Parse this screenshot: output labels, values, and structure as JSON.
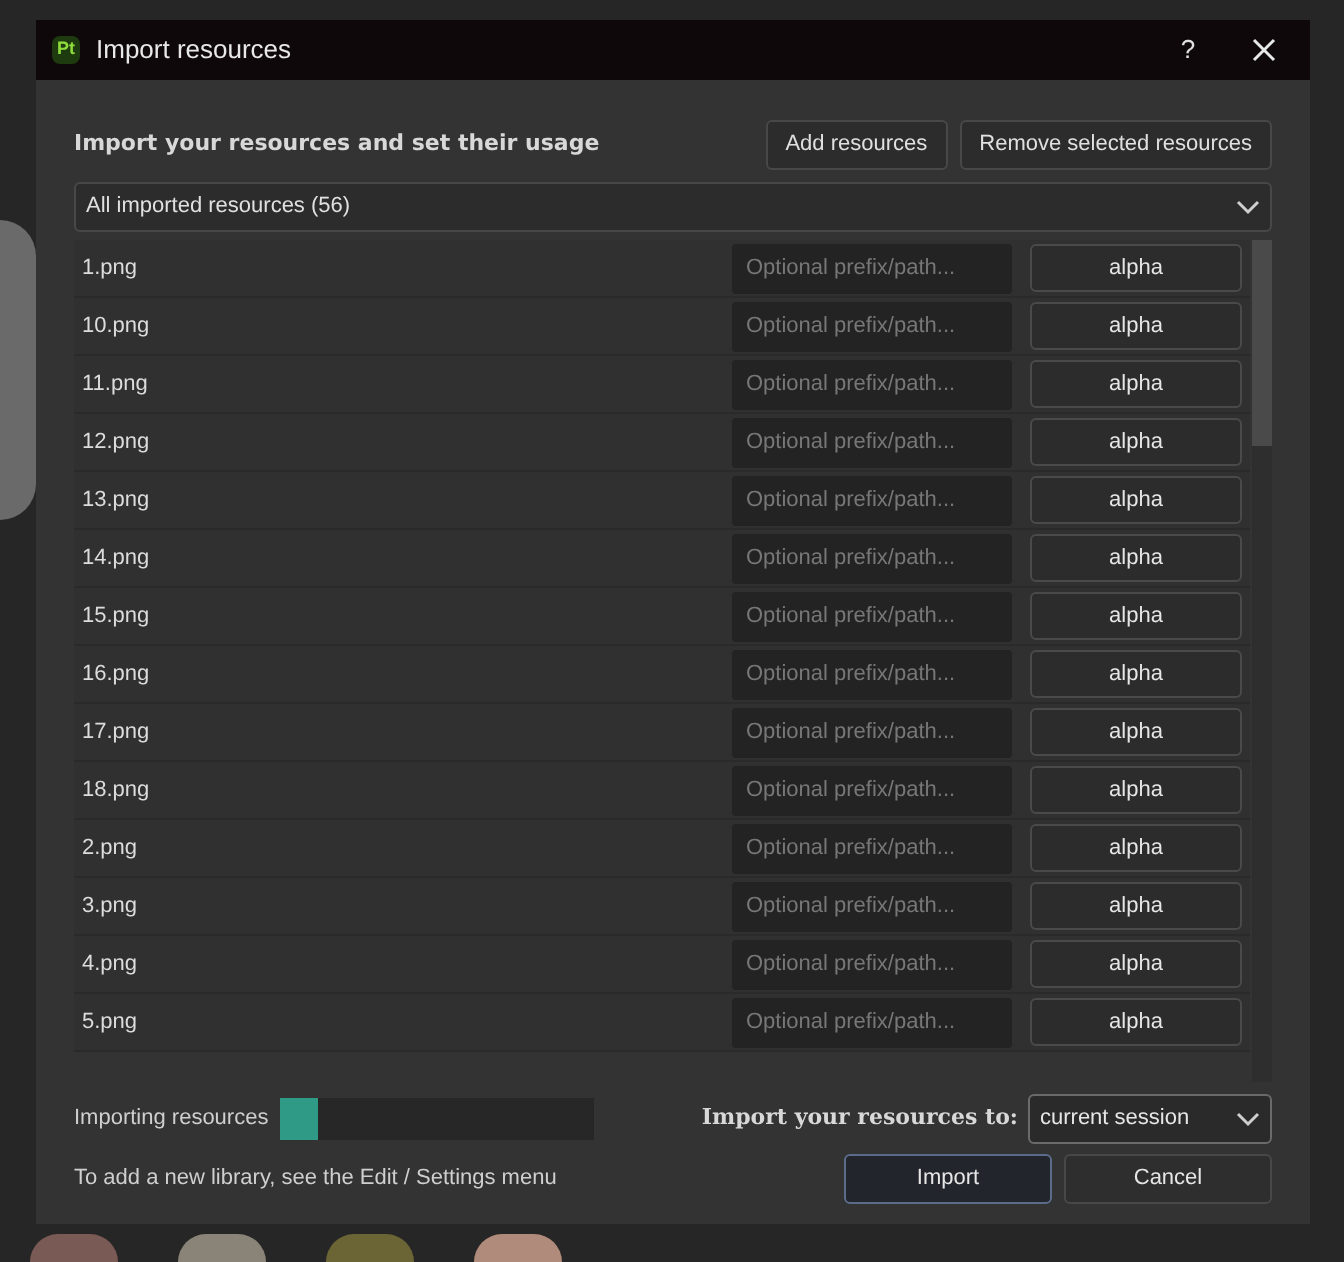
{
  "window": {
    "title": "Import resources",
    "app_badge": "Pt",
    "help": "?"
  },
  "header": {
    "title": "Import your resources and set their usage",
    "buttons": [
      "Add resources",
      "Remove selected resources"
    ]
  },
  "filter": {
    "value": "All imported resources (56)"
  },
  "resources": [
    {
      "name": "1.png",
      "placeholder": "Optional prefix/path...",
      "usage": "alpha"
    },
    {
      "name": "10.png",
      "placeholder": "Optional prefix/path...",
      "usage": "alpha"
    },
    {
      "name": "11.png",
      "placeholder": "Optional prefix/path...",
      "usage": "alpha"
    },
    {
      "name": "12.png",
      "placeholder": "Optional prefix/path...",
      "usage": "alpha"
    },
    {
      "name": "13.png",
      "placeholder": "Optional prefix/path...",
      "usage": "alpha"
    },
    {
      "name": "14.png",
      "placeholder": "Optional prefix/path...",
      "usage": "alpha"
    },
    {
      "name": "15.png",
      "placeholder": "Optional prefix/path...",
      "usage": "alpha"
    },
    {
      "name": "16.png",
      "placeholder": "Optional prefix/path...",
      "usage": "alpha"
    },
    {
      "name": "17.png",
      "placeholder": "Optional prefix/path...",
      "usage": "alpha"
    },
    {
      "name": "18.png",
      "placeholder": "Optional prefix/path...",
      "usage": "alpha"
    },
    {
      "name": "2.png",
      "placeholder": "Optional prefix/path...",
      "usage": "alpha"
    },
    {
      "name": "3.png",
      "placeholder": "Optional prefix/path...",
      "usage": "alpha"
    },
    {
      "name": "4.png",
      "placeholder": "Optional prefix/path...",
      "usage": "alpha"
    },
    {
      "name": "5.png",
      "placeholder": "Optional prefix/path...",
      "usage": "alpha"
    }
  ],
  "progress": {
    "label": "Importing resources",
    "level": 0.12
  },
  "destination": {
    "label": "Import your resources to:",
    "value": "current session"
  },
  "hint": "To add a new library, see the Edit / Settings menu",
  "footer_buttons": [
    {
      "label": "Import",
      "kind": "primary"
    },
    {
      "label": "Cancel",
      "kind": "normal"
    }
  ]
}
